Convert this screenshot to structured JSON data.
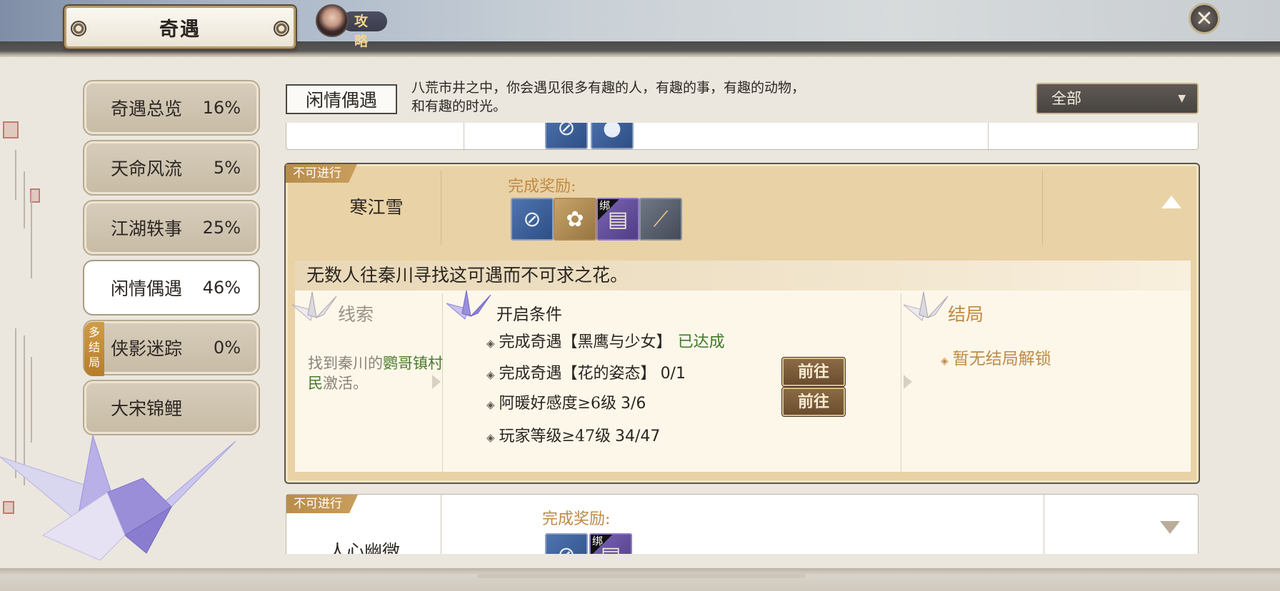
{
  "header": {
    "title": "奇遇",
    "guide_label": "攻略",
    "close_symbol": "✕"
  },
  "sidebar": {
    "items": [
      {
        "label": "奇遇总览",
        "pct": "16%"
      },
      {
        "label": "天命风流",
        "pct": "5%"
      },
      {
        "label": "江湖轶事",
        "pct": "25%"
      },
      {
        "label": "闲情偶遇",
        "pct": "46%"
      },
      {
        "label": "侠影迷踪",
        "pct": "0%"
      },
      {
        "label": "大宋锦鲤",
        "pct": ""
      }
    ],
    "multi_ending_badge": "多结局"
  },
  "category": {
    "title": "闲情偶遇",
    "description_line1": "八荒市井之中，你会遇见很多有趣的人，有趣的事，有趣的动物，",
    "description_line2": "和有趣的时光。"
  },
  "filter": {
    "selected": "全部",
    "caret": "▼"
  },
  "expanded_card": {
    "status": "不可进行",
    "name": "寒江雪",
    "reward_label": "完成奖励:",
    "rewards": [
      {
        "icon": "jade-pendant-icon",
        "glyph": "⊘"
      },
      {
        "icon": "lotus-icon",
        "glyph": "✿"
      },
      {
        "icon": "book-icon",
        "glyph": "▤",
        "bind": "绑"
      },
      {
        "icon": "scroll-icon",
        "glyph": "⟋"
      }
    ],
    "summary": "无数人往秦川寻找这可遇而不可求之花。",
    "clue_head": "线索",
    "clue_text_1": "找到秦川的",
    "clue_highlight": "鹦哥镇村民",
    "clue_text_2": "激活。",
    "conditions_head": "开启条件",
    "conditions": [
      {
        "text": "完成奇遇【黑鹰与少女】",
        "status": "已达成",
        "progress": ""
      },
      {
        "text": "完成奇遇【花的姿态】",
        "status": "",
        "progress": "0/1",
        "button": "前往"
      },
      {
        "text": "阿暖好感度≥6级",
        "status": "",
        "progress": "3/6",
        "button": "前往"
      },
      {
        "text": "玩家等级≥47级",
        "status": "",
        "progress": "34/47"
      }
    ],
    "ending_head": "结局",
    "ending_text": "暂无结局解锁"
  },
  "collapsed_card": {
    "status": "不可进行",
    "name": "人心幽微",
    "reward_label": "完成奖励:",
    "bind": "绑"
  },
  "colors": {
    "accent_gold": "#bf8a45",
    "done_green": "#3f7a2a",
    "card_expanded_bg": "#e9d2a6"
  }
}
